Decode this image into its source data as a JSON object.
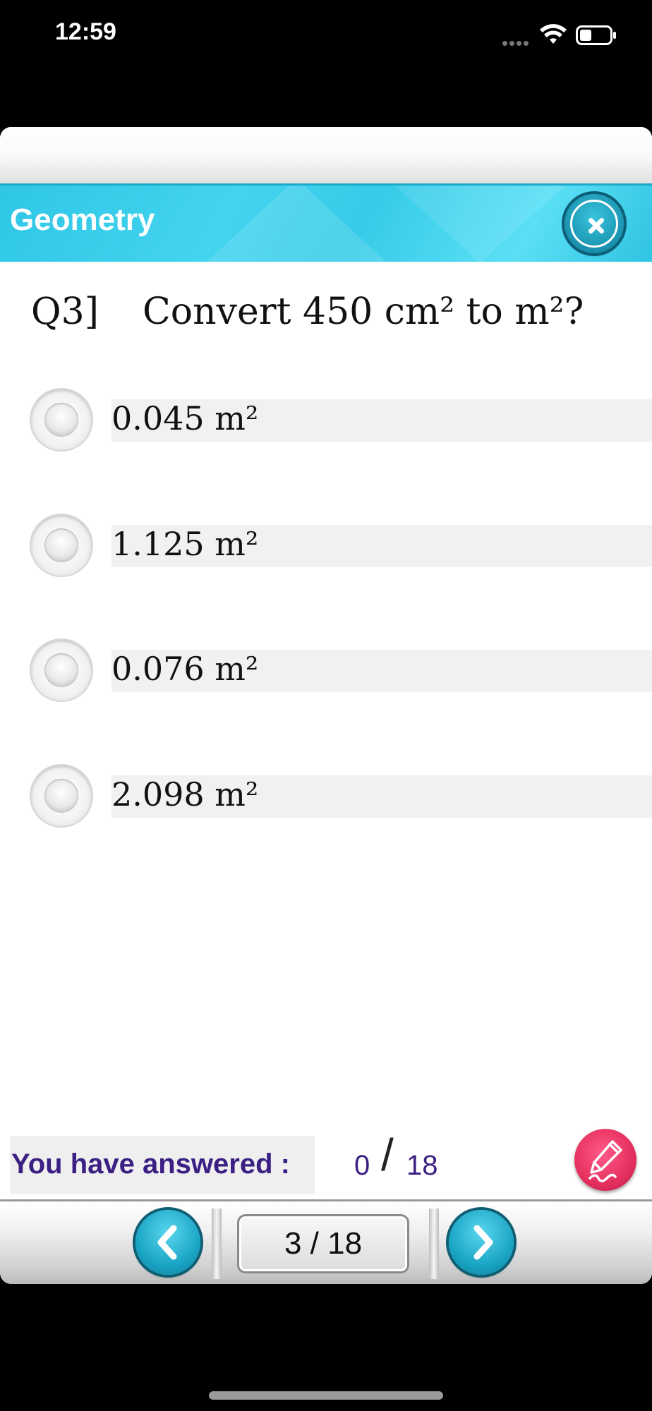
{
  "status_bar": {
    "time": "12:59",
    "icons": [
      "signal-icon",
      "wifi-icon",
      "battery-icon"
    ]
  },
  "header": {
    "title": "Geometry",
    "close_icon": "close-icon",
    "accent_color": "#36cbe9"
  },
  "question": {
    "number": "Q3]",
    "text": "Convert 450 cm² to m²?"
  },
  "options": [
    {
      "label": "0.045 m²",
      "selected": false
    },
    {
      "label": "1.125 m²",
      "selected": false
    },
    {
      "label": "0.076 m²",
      "selected": false
    },
    {
      "label": "2.098 m²",
      "selected": false
    }
  ],
  "progress": {
    "label": "You have answered :",
    "answered": "0",
    "separator": "/",
    "total": "18",
    "text_color": "#3b1f82"
  },
  "pen_button": {
    "icon": "pen-icon",
    "color": "#e5305f"
  },
  "navigation": {
    "prev_icon": "chevron-left-icon",
    "next_icon": "chevron-right-icon",
    "page": "3 / 18"
  }
}
